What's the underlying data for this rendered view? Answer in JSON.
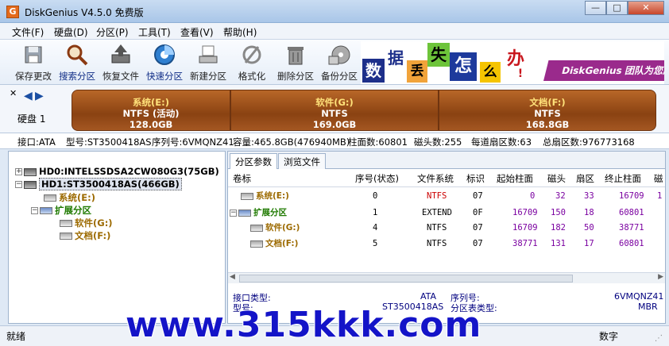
{
  "window": {
    "title": "DiskGenius V4.5.0 免费版",
    "app_icon": "G",
    "min": "—",
    "max": "□",
    "close": "✕"
  },
  "menu": [
    "文件(F)",
    "硬盘(D)",
    "分区(P)",
    "工具(T)",
    "查看(V)",
    "帮助(H)"
  ],
  "toolbar": [
    {
      "label": "保存更改",
      "icon": "save-icon"
    },
    {
      "label": "搜索分区",
      "icon": "search-icon"
    },
    {
      "label": "恢复文件",
      "icon": "recover-icon"
    },
    {
      "label": "快速分区",
      "icon": "quick-partition-icon"
    },
    {
      "label": "新建分区",
      "icon": "new-partition-icon"
    },
    {
      "label": "格式化",
      "icon": "format-icon"
    },
    {
      "label": "删除分区",
      "icon": "delete-icon"
    },
    {
      "label": "备份分区",
      "icon": "backup-icon"
    }
  ],
  "banner": {
    "chars": [
      "数",
      "据",
      "丢",
      "失",
      "怎",
      "么",
      "办",
      "!"
    ],
    "text": "DiskGenius 团队为您服"
  },
  "diskbar": {
    "label": "硬盘 1",
    "partitions": [
      {
        "name": "系统(E:)",
        "fs": "NTFS (活动)",
        "size": "128.0GB"
      },
      {
        "name": "软件(G:)",
        "fs": "NTFS",
        "size": "169.0GB"
      },
      {
        "name": "文档(F:)",
        "fs": "NTFS",
        "size": "168.8GB"
      }
    ]
  },
  "info": {
    "iface": "接口:ATA",
    "model": "型号:ST3500418AS",
    "serial": "序列号:6VMQNZ41",
    "capacity": "容量:465.8GB(476940MB)",
    "cyl": "柱面数:60801",
    "heads": "磁头数:255",
    "spt": "每道扇区数:63",
    "total": "总扇区数:976773168"
  },
  "tree": [
    {
      "text": "HD0:INTELSSDSA2CW080G3(75GB)"
    },
    {
      "text": "HD1:ST3500418AS(466GB)"
    },
    {
      "text": "系统(E:)"
    },
    {
      "text": "扩展分区"
    },
    {
      "text": "软件(G:)"
    },
    {
      "text": "文档(F:)"
    }
  ],
  "tabs": [
    "分区参数",
    "浏览文件"
  ],
  "table": {
    "headers": [
      "卷标",
      "序号(状态)",
      "文件系统",
      "标识",
      "起始柱面",
      "磁头",
      "扇区",
      "终止柱面",
      "磁"
    ],
    "rows": [
      [
        "系统(E:)",
        "0",
        "NTFS",
        "07",
        "0",
        "32",
        "33",
        "16709",
        "1"
      ],
      [
        "扩展分区",
        "1",
        "EXTEND",
        "0F",
        "16709",
        "150",
        "18",
        "60801",
        ""
      ],
      [
        "软件(G:)",
        "4",
        "NTFS",
        "07",
        "16709",
        "182",
        "50",
        "38771",
        ""
      ],
      [
        "文档(F:)",
        "5",
        "NTFS",
        "07",
        "38771",
        "131",
        "17",
        "60801",
        ""
      ]
    ]
  },
  "details": {
    "iface_label": "接口类型:",
    "iface_value": "ATA",
    "serial_label": "序列号:",
    "serial_value": "6VMQNZ41",
    "model_label": "型号:",
    "model_value": "ST3500418AS",
    "pt_label": "分区表类型:",
    "pt_value": "MBR"
  },
  "status": {
    "ready": "就绪",
    "num": "数字"
  },
  "watermark": "www.315kkk.com",
  "colors": {
    "partition": "#8a4212",
    "partition_name": "#ffe27a",
    "tree_orange": "#9c6a00",
    "tree_green": "#1f7a00",
    "fs_red": "#cc0000",
    "num_purple": "#7a00a0",
    "num_blue": "#0000c0"
  }
}
